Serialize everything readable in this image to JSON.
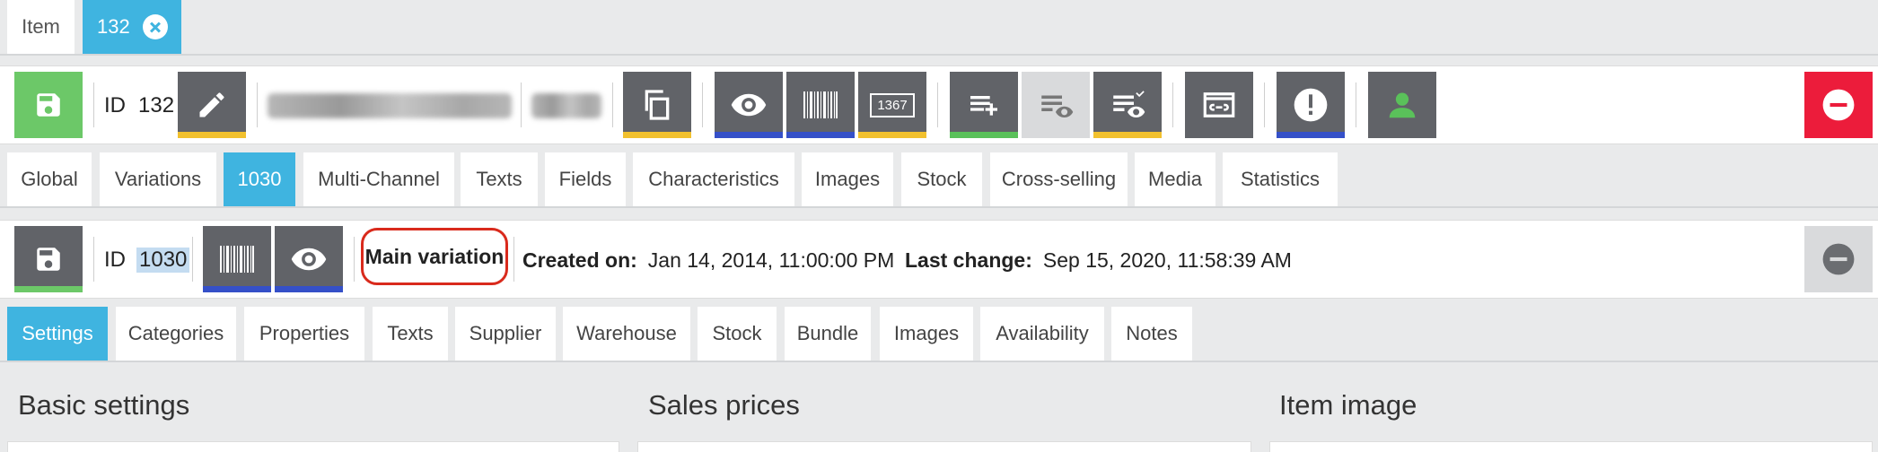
{
  "doc_tabs": {
    "item_label": "Item",
    "active_label": "132"
  },
  "item_toolbar": {
    "id_label": "ID",
    "id_value": "132",
    "variation_number_badge": "1367"
  },
  "item_tabs": [
    "Global",
    "Variations",
    "1030",
    "Multi-Channel",
    "Texts",
    "Fields",
    "Characteristics",
    "Images",
    "Stock",
    "Cross-selling",
    "Media",
    "Statistics"
  ],
  "variation_toolbar": {
    "id_label": "ID",
    "id_value": "1030",
    "main_variation": "Main variation",
    "created_label": "Created on:",
    "created_value": "Jan 14, 2014, 11:00:00 PM",
    "changed_label": "Last change:",
    "changed_value": "Sep 15, 2020, 11:58:39 AM"
  },
  "variation_tabs": [
    "Settings",
    "Categories",
    "Properties",
    "Texts",
    "Supplier",
    "Warehouse",
    "Stock",
    "Bundle",
    "Images",
    "Availability",
    "Notes"
  ],
  "sections": {
    "basic": "Basic settings",
    "prices": "Sales prices",
    "image": "Item image"
  },
  "colors": {
    "accent": "#3fb4e0",
    "save_green": "#6cc868",
    "bar_yellow": "#f2c12e",
    "bar_blue": "#3550c8",
    "bar_green": "#5ac15a",
    "danger": "#ec1c3b",
    "highlight": "#d92a1c"
  }
}
